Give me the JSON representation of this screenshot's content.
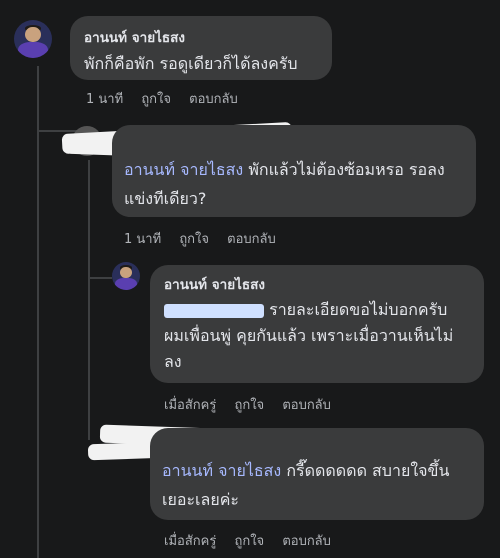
{
  "comments": [
    {
      "author": "อานนท์ จายไธสง",
      "text": "พักก็คือพัก รอดูเดียวก็ได้ลงครับ",
      "time": "1 นาที",
      "like": "ถูกใจ",
      "reply": "ตอบกลับ"
    },
    {
      "mention": "อานนท์ จายไธสง",
      "text_line1": "พักแล้วไม่ต้องซ้อมหรอ รอลง",
      "text_line2": "แข่งทีเดียว?",
      "time": "1 นาที",
      "like": "ถูกใจ",
      "reply": "ตอบกลับ"
    },
    {
      "author": "อานนท์ จายไธสง",
      "text_line1": "รายละเอียดขอไม่บอกครับ",
      "text_line2": "ผมเพื่อนพู่ คุยกันแล้ว เพราะเมื่อวานเห็นไม่",
      "text_line3": "ลง",
      "time": "เมื่อสักครู่",
      "like": "ถูกใจ",
      "reply": "ตอบกลับ"
    },
    {
      "mention": "อานนท์ จายไธสง",
      "text_line1": "กรี๊ดดดดดด สบายใจขึ้น",
      "text_line2": "เยอะเลยค่ะ",
      "time": "เมื่อสักครู่",
      "like": "ถูกใจ",
      "reply": "ตอบกลับ"
    }
  ],
  "colors": {
    "background": "#18191a",
    "bubble": "#3a3b3c",
    "mention": "#a7b9ff",
    "meta": "#b0b3b8"
  }
}
